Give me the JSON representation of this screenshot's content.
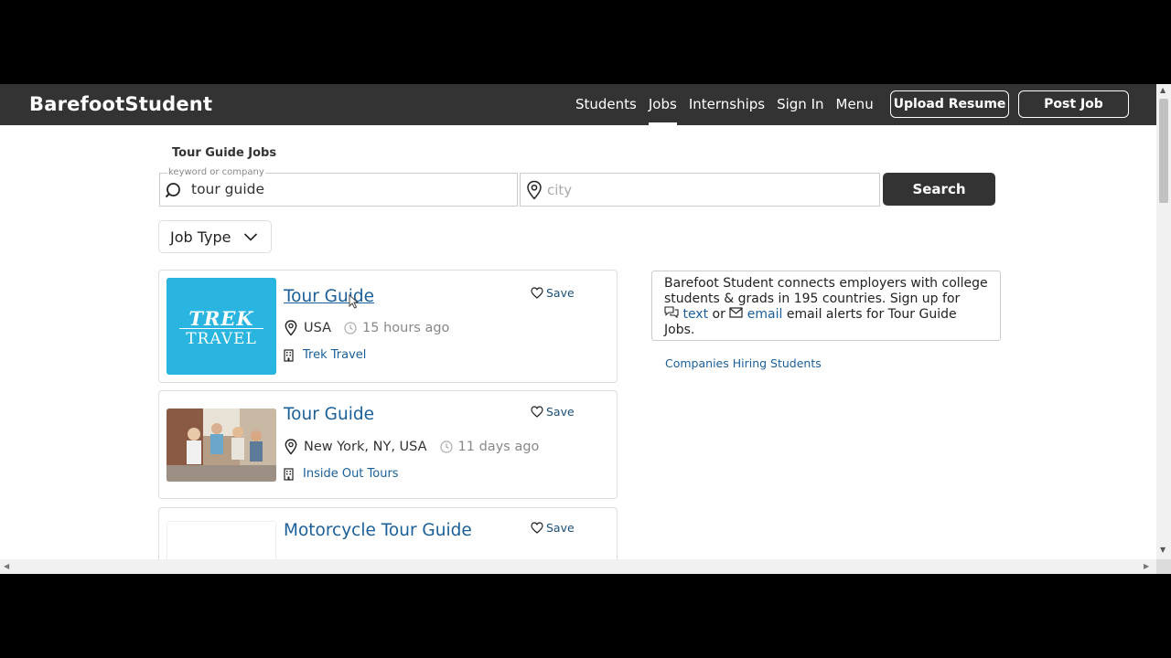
{
  "nav": {
    "brand": "BarefootStudent",
    "links": [
      "Students",
      "Jobs",
      "Internships",
      "Sign In",
      "Menu"
    ],
    "upload_label": "Upload Resume",
    "post_label": "Post Job"
  },
  "page": {
    "heading": "Tour Guide Jobs"
  },
  "search": {
    "keyword_label": "keyword or company",
    "keyword_value": "tour guide",
    "city_placeholder": "city",
    "button_label": "Search"
  },
  "filter": {
    "job_type_label": "Job Type"
  },
  "jobs": [
    {
      "title": "Tour Guide",
      "location": "USA",
      "posted": "15 hours ago",
      "company": "Trek Travel",
      "save_label": "Save",
      "logo_line1": "TREK",
      "logo_line2": "TRAVEL"
    },
    {
      "title": "Tour Guide",
      "location": "New York, NY, USA",
      "posted": "11 days ago",
      "company": "Inside Out Tours",
      "save_label": "Save"
    },
    {
      "title": "Motorcycle Tour Guide",
      "save_label": "Save"
    }
  ],
  "sidebar": {
    "info_pre": "Barefoot Student connects employers with college students & grads in 195 countries. Sign up for",
    "text_link": "text",
    "or_word": "or",
    "email_link": "email",
    "info_post": "email alerts for Tour Guide Jobs.",
    "companies_link": "Companies Hiring Students"
  },
  "colors": {
    "navbar": "#333333",
    "link": "#1a5f9a",
    "trek_bg": "#2ab4e0"
  }
}
